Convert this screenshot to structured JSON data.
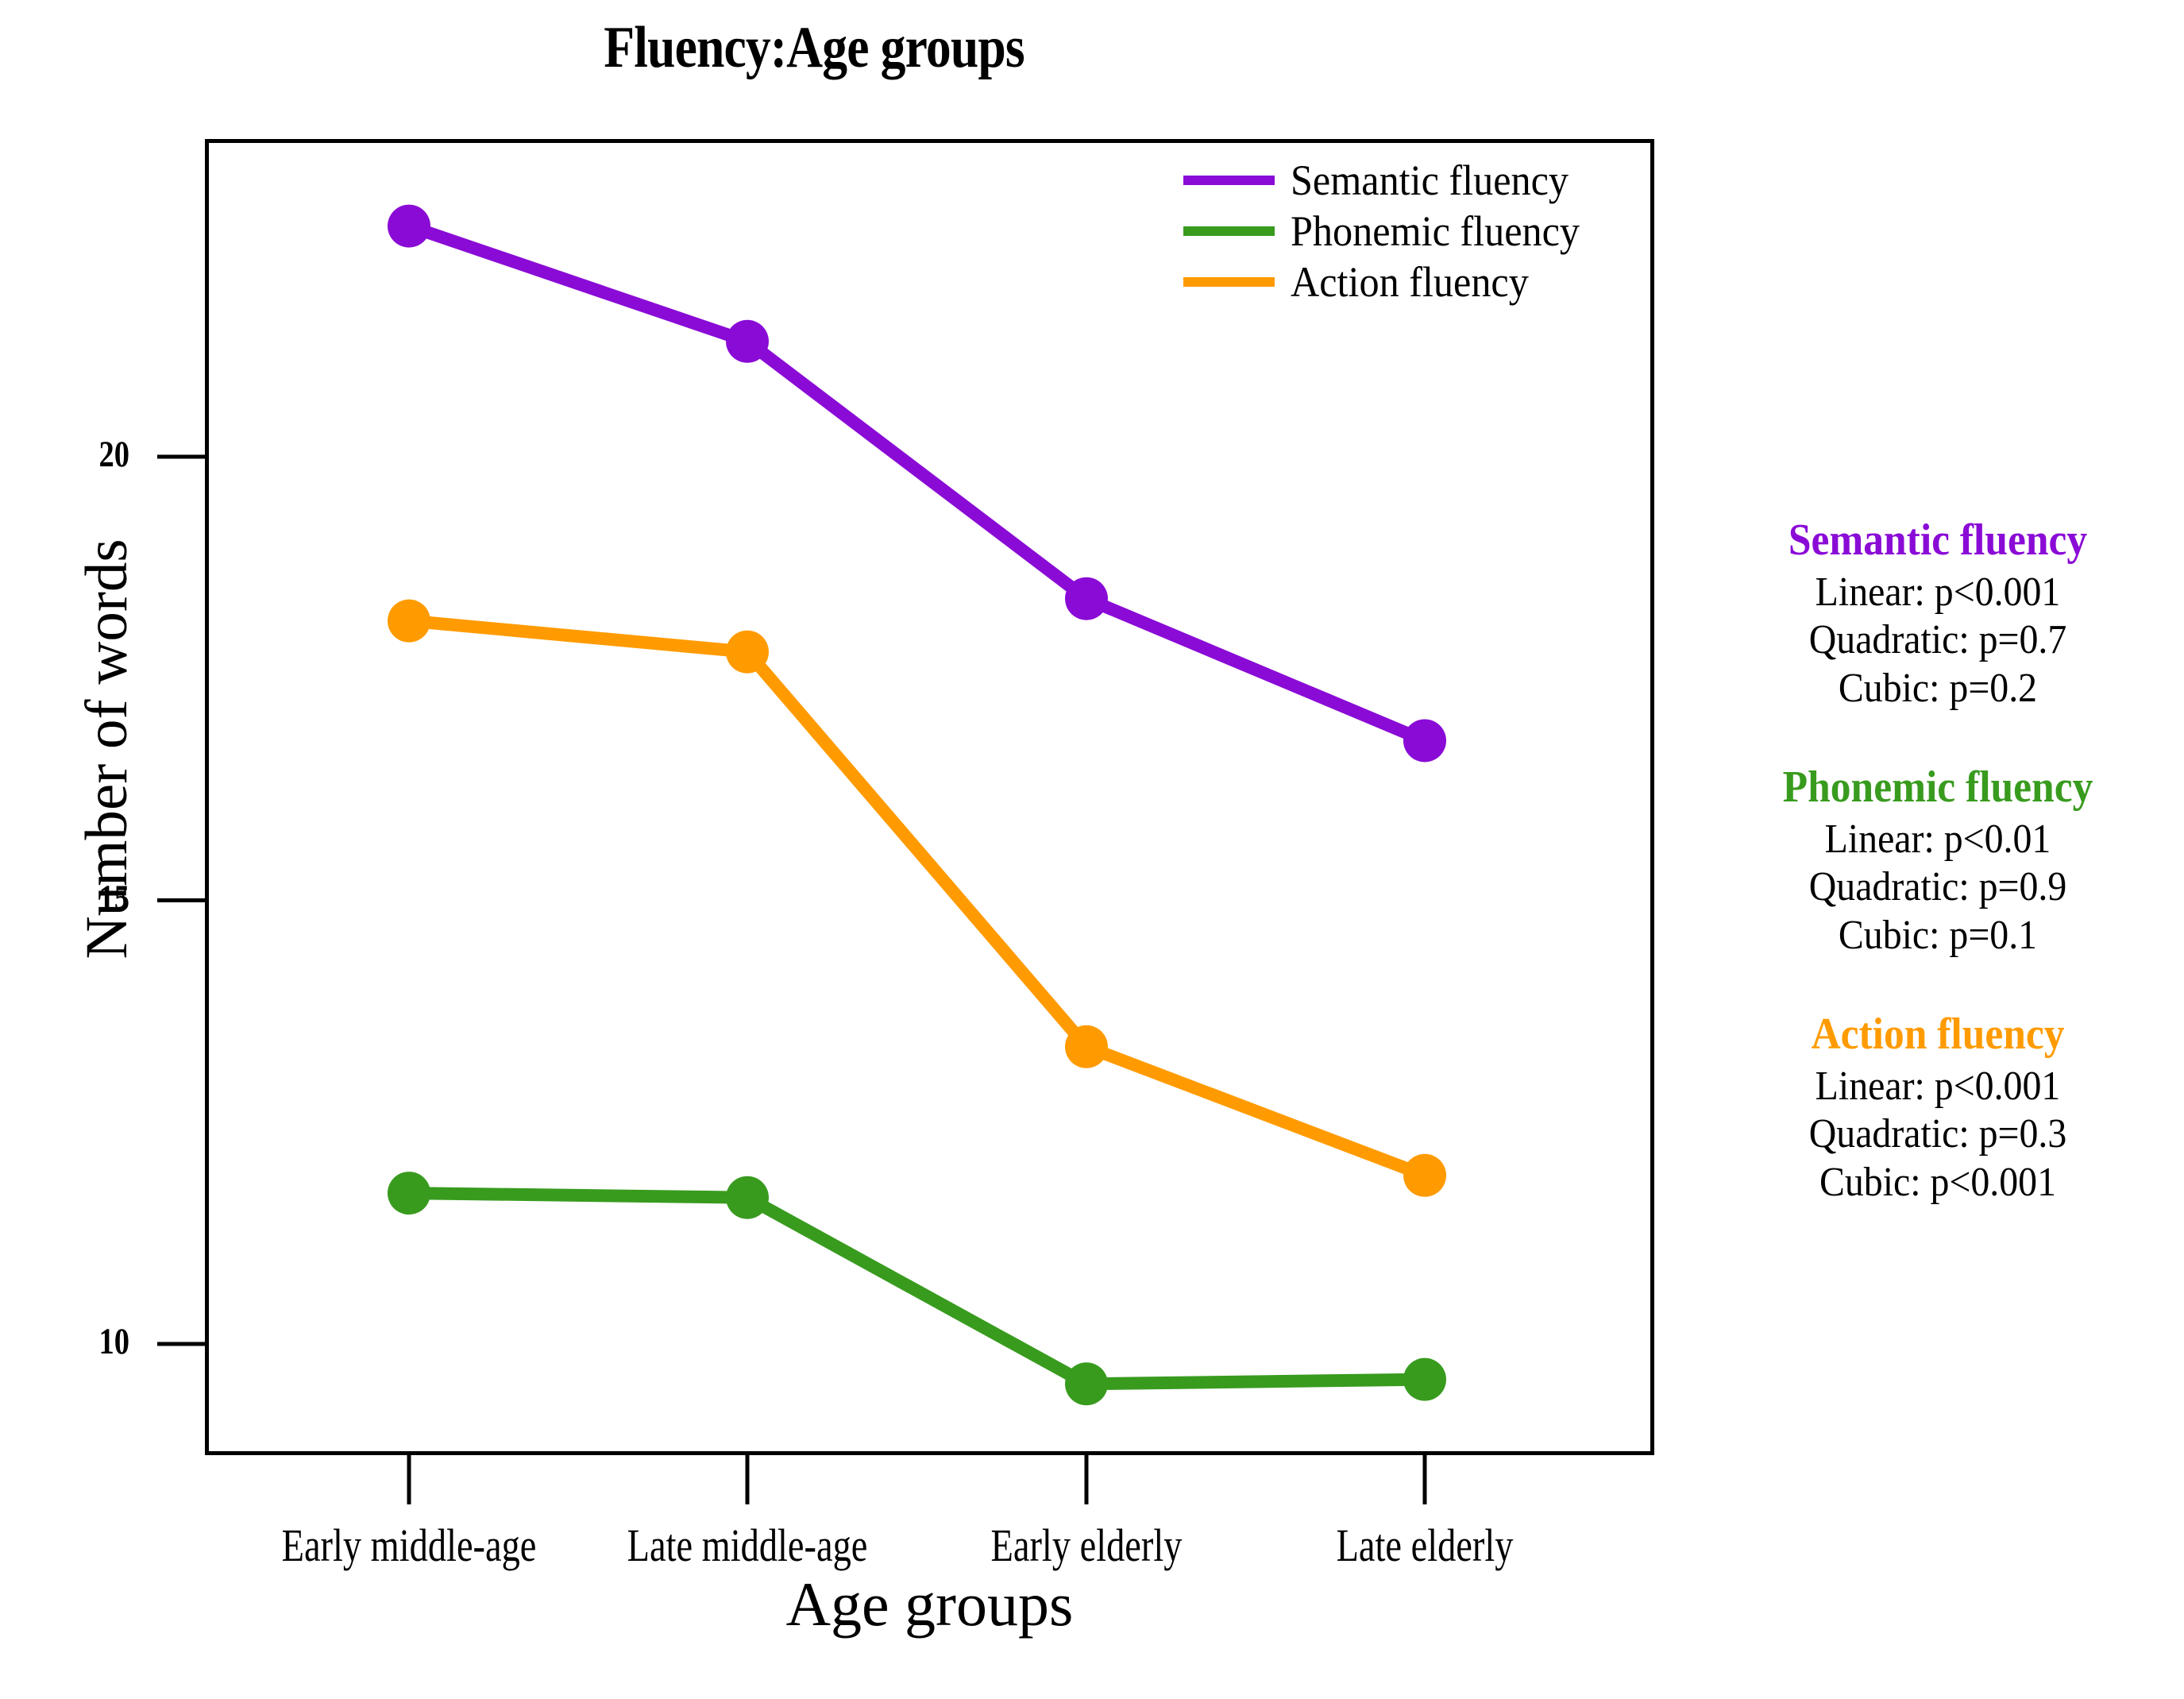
{
  "title": "Fluency:Age groups",
  "axes": {
    "xlabel": "Age groups",
    "ylabel": "Number of words",
    "yticks": [
      "20",
      "15",
      "10"
    ],
    "xticks": [
      "Early middle-age",
      "Late middle-age",
      "Early elderly",
      "Late elderly"
    ]
  },
  "colors": {
    "semantic": "#8A0BD6",
    "phonemic": "#389B1E",
    "action": "#FF9B00",
    "axis": "#000000",
    "background": "#FFFFFF"
  },
  "legend": {
    "position": "top-right-inside",
    "items": [
      {
        "label": "Semantic fluency",
        "color": "#8A0BD6"
      },
      {
        "label": "Phonemic fluency",
        "color": "#389B1E"
      },
      {
        "label": "Action fluency",
        "color": "#FF9B00"
      }
    ]
  },
  "annotations": [
    {
      "heading": "Semantic fluency",
      "color": "#8A0BD6",
      "lines": [
        "Linear: p<0.001",
        "Quadratic: p=0.7",
        "Cubic: p=0.2"
      ]
    },
    {
      "heading": "Phonemic fluency",
      "color": "#389B1E",
      "lines": [
        "Linear: p<0.01",
        "Quadratic: p=0.9",
        "Cubic: p=0.1"
      ]
    },
    {
      "heading": "Action fluency",
      "color": "#FF9B00",
      "lines": [
        "Linear: p<0.001",
        "Quadratic: p=0.3",
        "Cubic: p<0.001"
      ]
    }
  ],
  "chart_data": {
    "type": "line",
    "title": "Fluency:Age groups",
    "xlabel": "Age groups",
    "ylabel": "Number of words",
    "categories": [
      "Early middle-age",
      "Late middle-age",
      "Early elderly",
      "Late elderly"
    ],
    "ylim": [
      8.6,
      23.6
    ],
    "yticks": [
      10,
      15,
      20
    ],
    "grid": false,
    "legend_position": "upper right",
    "markers": "filled circles",
    "series": [
      {
        "name": "Semantic fluency",
        "color": "#8A0BD6",
        "values": [
          22.6,
          21.3,
          18.4,
          16.8
        ]
      },
      {
        "name": "Phonemic fluency",
        "color": "#389B1E",
        "values": [
          11.7,
          11.65,
          9.55,
          9.6
        ]
      },
      {
        "name": "Action fluency",
        "color": "#FF9B00",
        "values": [
          18.15,
          17.8,
          13.35,
          11.9
        ]
      }
    ]
  }
}
